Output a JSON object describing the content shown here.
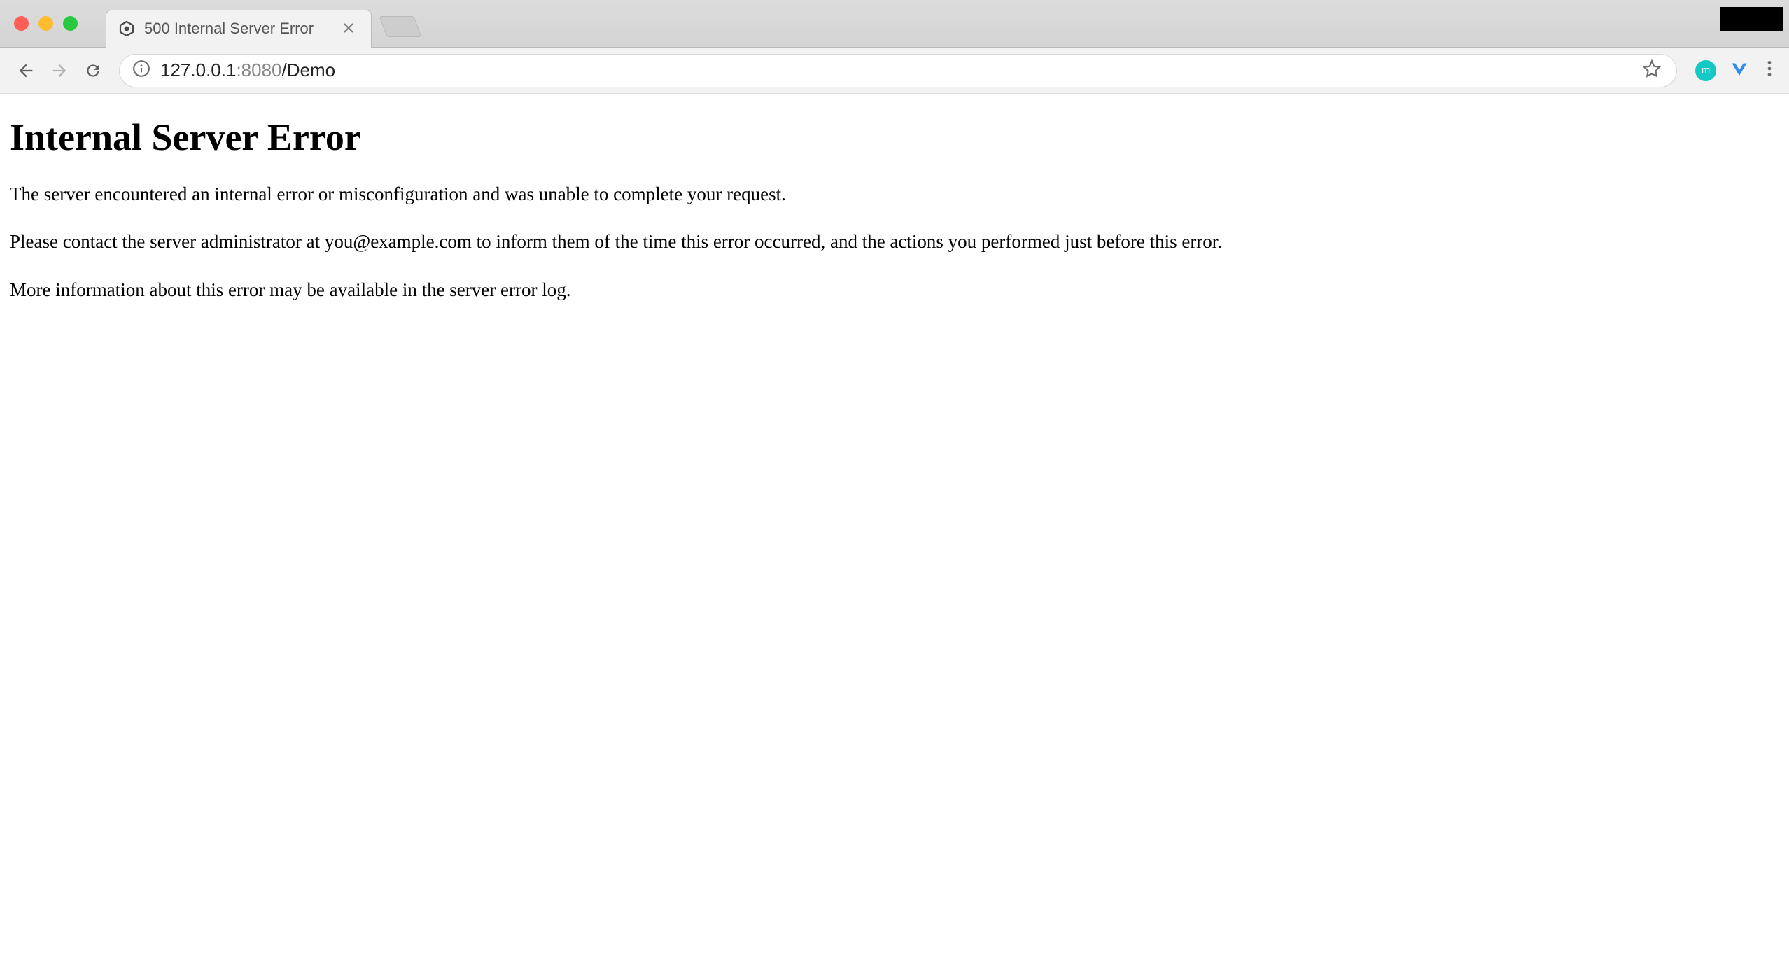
{
  "browser": {
    "tab": {
      "title": "500 Internal Server Error"
    },
    "address": {
      "host": "127.0.0.1",
      "port": ":8080",
      "path": "/Demo"
    }
  },
  "page": {
    "heading": "Internal Server Error",
    "paragraph1": "The server encountered an internal error or misconfiguration and was unable to complete your request.",
    "paragraph2": "Please contact the server administrator at you@example.com to inform them of the time this error occurred, and the actions you performed just before this error.",
    "paragraph3": "More information about this error may be available in the server error log."
  }
}
